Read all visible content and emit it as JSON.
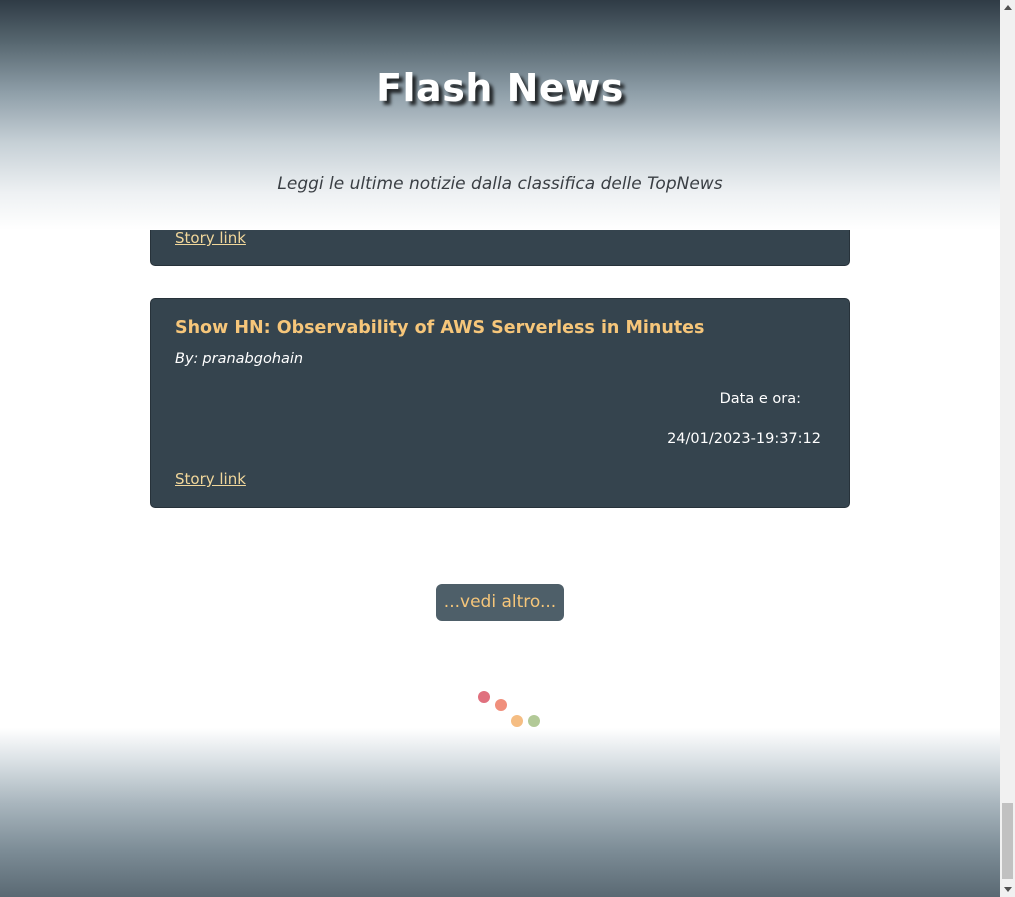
{
  "header": {
    "title": "Flash News",
    "subtitle": "Leggi le ultime notizie dalla classifica delle TopNews"
  },
  "stories": [
    {
      "story_link_label": "Story link"
    },
    {
      "title": "Show HN: Observability of AWS Serverless in Minutes",
      "author_prefix": "By:",
      "author": "pranabgohain",
      "date_label": "Data e ora:",
      "date_value": "24/01/2023-19:37:12",
      "story_link_label": "Story link"
    }
  ],
  "more_button": {
    "label": "...vedi altro..."
  },
  "loader": {
    "dot_colors": [
      "#e0707e",
      "#f08f7c",
      "#f5bd83",
      "#b2c997"
    ]
  },
  "colors": {
    "card_background": "#35444e",
    "title_accent": "#f6c67a",
    "link_color": "#f1d79b",
    "button_background": "#4e5f69"
  }
}
